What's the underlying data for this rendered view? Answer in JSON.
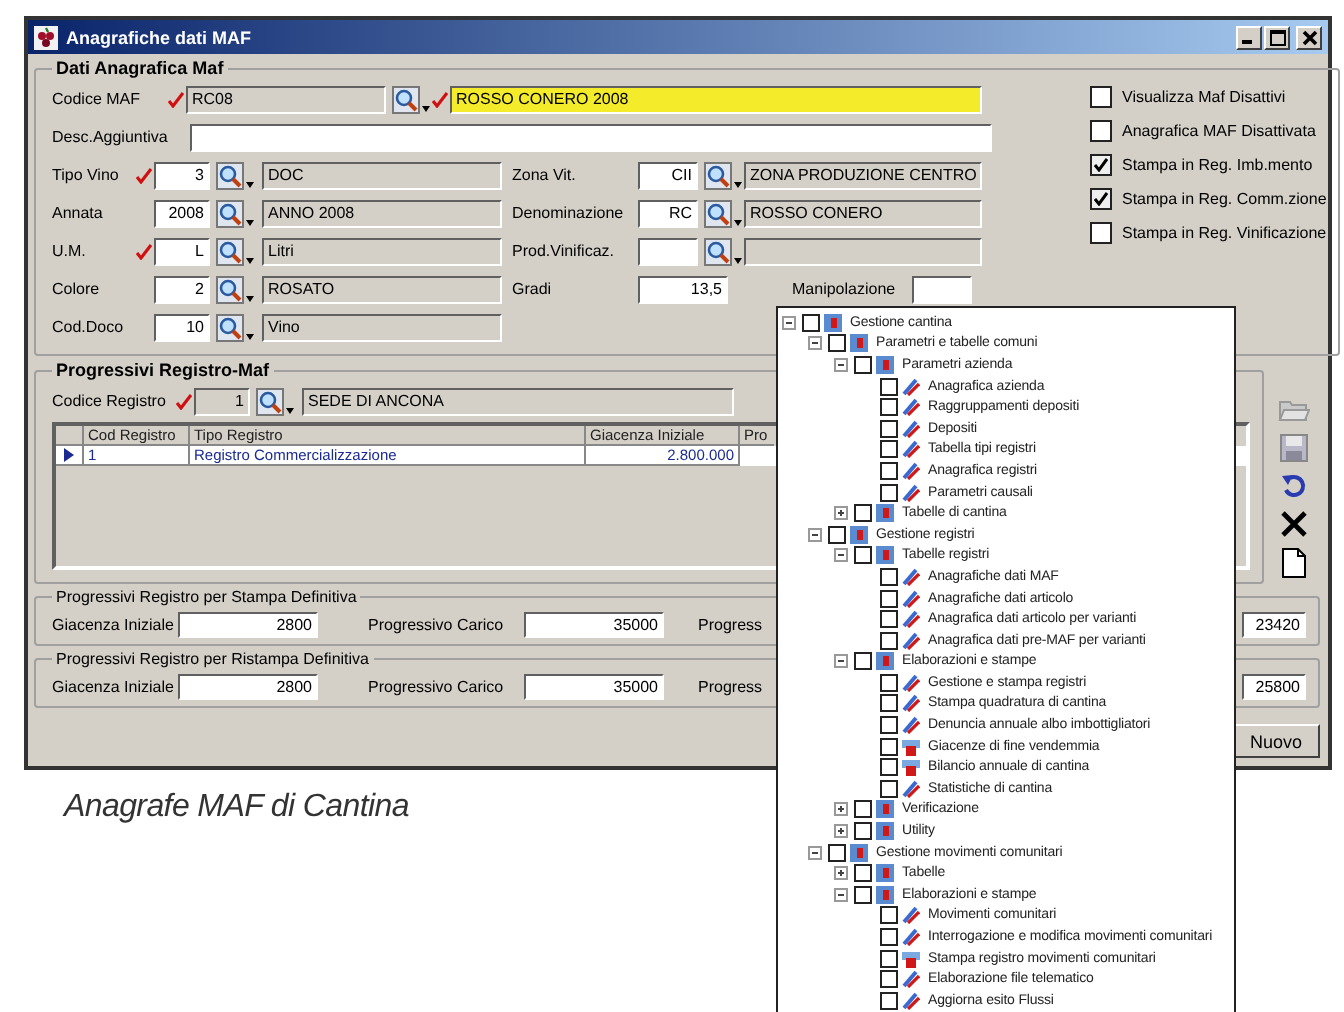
{
  "window": {
    "title": "Anagrafiche dati MAF"
  },
  "anagrafica": {
    "title": "Dati Anagrafica Maf",
    "codice_maf": {
      "label": "Codice MAF",
      "required": true,
      "code": "RC08",
      "description": "ROSSO CONERO 2008",
      "description_required": true
    },
    "desc_aggiuntiva": {
      "label": "Desc.Aggiuntiva"
    },
    "left_fields": [
      {
        "label": "Tipo Vino",
        "required": true,
        "code": "3",
        "description": "DOC"
      },
      {
        "label": "Annata",
        "required": false,
        "code": "2008",
        "description": "ANNO 2008"
      },
      {
        "label": "U.M.",
        "required": true,
        "code": "L",
        "description": "Litri"
      },
      {
        "label": "Colore",
        "required": false,
        "code": "2",
        "description": "ROSATO"
      },
      {
        "label": "Cod.Doco",
        "required": false,
        "code": "10",
        "description": "Vino"
      }
    ],
    "right_fields": [
      {
        "kind": "lookup",
        "label": "Zona Vit.",
        "code": "CII",
        "description": "ZONA PRODUZIONE CENTRO"
      },
      {
        "kind": "lookup",
        "label": "Denominazione",
        "code": "RC",
        "description": "ROSSO CONERO"
      },
      {
        "kind": "lookup",
        "label": "Prod.Vinificaz."
      },
      {
        "kind": "number",
        "label": "Gradi",
        "value": "13,5"
      }
    ],
    "manipolazione": {
      "label": "Manipolazione"
    },
    "options": [
      {
        "label": "Visualizza Maf Disattivi",
        "checked": false
      },
      {
        "label": "Anagrafica MAF Disattivata",
        "checked": false
      },
      {
        "label": "Stampa in Reg. Imb.mento",
        "checked": true
      },
      {
        "label": "Stampa in Reg. Comm.zione",
        "checked": true
      },
      {
        "label": "Stampa in Reg. Vinificazione",
        "checked": false
      }
    ]
  },
  "progressivi": {
    "title": "Progressivi Registro-Maf",
    "codice_registro": {
      "label": "Codice Registro",
      "required": true,
      "code": "1",
      "description": "SEDE DI ANCONA"
    },
    "grid": {
      "columns": [
        "Cod Registro",
        "Tipo Registro",
        "Giacenza Iniziale",
        "Pro"
      ],
      "rows": [
        {
          "selected": true,
          "cells": [
            "1",
            "Registro Commercializzazione",
            "2.800.000"
          ]
        }
      ]
    }
  },
  "stampa_definitiva": {
    "title": "Progressivi Registro per Stampa Definitiva",
    "fields": [
      {
        "label": "Giacenza Iniziale",
        "value": "2800"
      },
      {
        "label": "Progressivo Carico",
        "value": "35000"
      },
      {
        "label": "Progress",
        "value": "23420"
      }
    ]
  },
  "ristampa_definitiva": {
    "title": "Progressivi Registro per  Ristampa Definitiva",
    "fields": [
      {
        "label": "Giacenza Iniziale",
        "value": "2800"
      },
      {
        "label": "Progressivo Carico",
        "value": "35000"
      },
      {
        "label": "Progress",
        "value": "25800"
      }
    ]
  },
  "buttons": [
    "Nuovo"
  ],
  "tree": [
    {
      "label": "Gestione cantina",
      "kind": "group",
      "expanded": true,
      "checked": false,
      "children": [
        {
          "label": "Parametri e tabelle comuni",
          "kind": "group",
          "expanded": true,
          "checked": false,
          "children": [
            {
              "label": "Parametri azienda",
              "kind": "group",
              "expanded": true,
              "checked": false,
              "children": [
                {
                  "label": "Anagrafica azienda",
                  "kind": "form",
                  "checked": false
                },
                {
                  "label": "Raggruppamenti depositi",
                  "kind": "form",
                  "checked": false
                },
                {
                  "label": "Depositi",
                  "kind": "form",
                  "checked": false
                },
                {
                  "label": "Tabella tipi registri",
                  "kind": "form",
                  "checked": false
                },
                {
                  "label": "Anagrafica registri",
                  "kind": "form",
                  "checked": false
                },
                {
                  "label": "Parametri causali",
                  "kind": "form",
                  "checked": false
                }
              ]
            },
            {
              "label": "Tabelle di cantina",
              "kind": "group",
              "expanded": false,
              "checked": false
            }
          ]
        },
        {
          "label": "Gestione registri",
          "kind": "group",
          "expanded": true,
          "checked": false,
          "children": [
            {
              "label": "Tabelle registri",
              "kind": "group",
              "expanded": true,
              "checked": false,
              "children": [
                {
                  "label": "Anagrafiche dati MAF",
                  "kind": "form",
                  "checked": false
                },
                {
                  "label": "Anagrafiche dati articolo",
                  "kind": "form",
                  "checked": false
                },
                {
                  "label": "Anagrafica dati articolo per varianti",
                  "kind": "form",
                  "checked": false
                },
                {
                  "label": "Anagrafica dati pre-MAF per varianti",
                  "kind": "form",
                  "checked": false
                }
              ]
            },
            {
              "label": "Elaborazioni e stampe",
              "kind": "group",
              "expanded": true,
              "checked": false,
              "children": [
                {
                  "label": "Gestione e stampa registri",
                  "kind": "form",
                  "checked": false
                },
                {
                  "label": "Stampa quadratura di cantina",
                  "kind": "form",
                  "checked": false
                },
                {
                  "label": "Denuncia annuale albo imbottigliatori",
                  "kind": "form",
                  "checked": false
                },
                {
                  "label": "Giacenze di fine vendemmia",
                  "kind": "report",
                  "checked": false
                },
                {
                  "label": "Bilancio annuale di cantina",
                  "kind": "report",
                  "checked": false
                },
                {
                  "label": "Statistiche di cantina",
                  "kind": "form",
                  "checked": false
                }
              ]
            },
            {
              "label": "Verificazione",
              "kind": "group",
              "expanded": false,
              "checked": false
            },
            {
              "label": "Utility",
              "kind": "group",
              "expanded": false,
              "checked": false
            }
          ]
        },
        {
          "label": "Gestione movimenti comunitari",
          "kind": "group",
          "expanded": true,
          "checked": false,
          "children": [
            {
              "label": "Tabelle",
              "kind": "group",
              "expanded": false,
              "checked": false
            },
            {
              "label": "Elaborazioni e stampe",
              "kind": "group",
              "expanded": true,
              "checked": false,
              "children": [
                {
                  "label": "Movimenti comunitari",
                  "kind": "form",
                  "checked": false
                },
                {
                  "label": "Interrogazione e modifica movimenti comunitari",
                  "kind": "form",
                  "checked": false
                },
                {
                  "label": "Stampa registro movimenti comunitari",
                  "kind": "report",
                  "checked": false
                },
                {
                  "label": "Elaborazione file telematico",
                  "kind": "form",
                  "checked": false
                },
                {
                  "label": "Aggiorna esito Flussi",
                  "kind": "form",
                  "checked": false
                }
              ]
            }
          ]
        }
      ]
    }
  ],
  "caption": "Anagrafe MAF di Cantina"
}
